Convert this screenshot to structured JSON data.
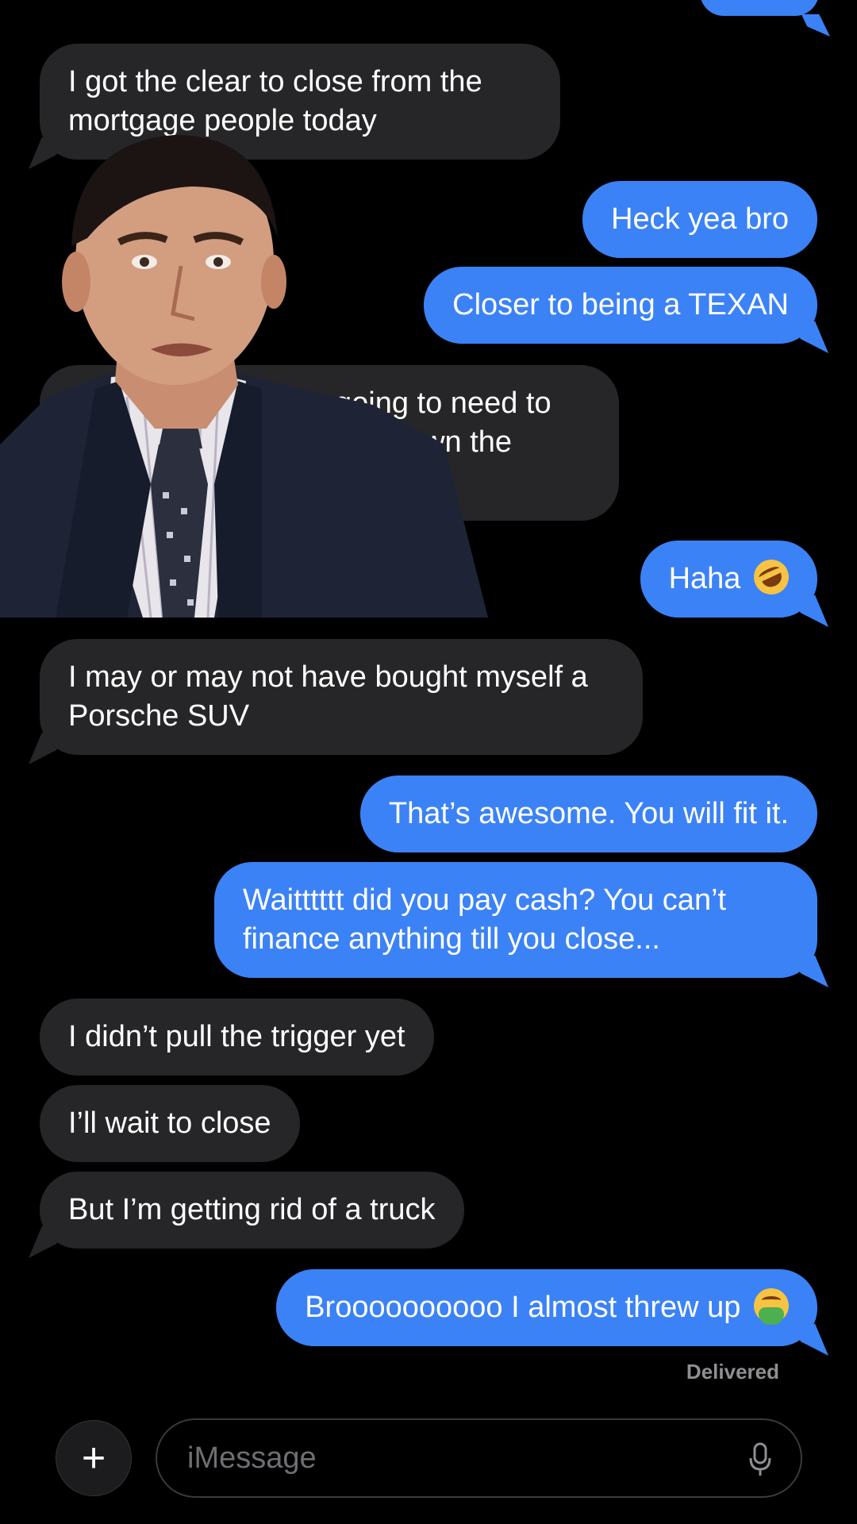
{
  "messages": [
    {
      "id": "m1",
      "dir": "recv",
      "text": "I got the clear to close from the mortgage people today"
    },
    {
      "id": "m2",
      "dir": "sent",
      "text": "Heck yea bro"
    },
    {
      "id": "m3",
      "dir": "sent",
      "text": "Closer to being a TEXAN"
    },
    {
      "id": "m4",
      "dir": "recv",
      "text": "I'm going to need to act like I own the place"
    },
    {
      "id": "m5",
      "dir": "sent",
      "text": "Haha"
    },
    {
      "id": "m6",
      "dir": "recv",
      "text": "I may or may not have bought myself a Porsche SUV"
    },
    {
      "id": "m7",
      "dir": "sent",
      "text": "That’s awesome. You will fit it."
    },
    {
      "id": "m8",
      "dir": "sent",
      "text": "Waitttttt did you pay cash? You can’t finance anything till you close..."
    },
    {
      "id": "m9",
      "dir": "recv",
      "text": "I didn’t pull the trigger yet"
    },
    {
      "id": "m10",
      "dir": "recv",
      "text": "I’ll wait to close"
    },
    {
      "id": "m11",
      "dir": "recv",
      "text": "But I’m getting rid of a truck"
    },
    {
      "id": "m12",
      "dir": "sent",
      "text": "Broooooooooo I almost threw up"
    }
  ],
  "emojis": {
    "m5": "rolling-on-floor-laughing",
    "m12": "face-vomiting"
  },
  "status": "Delivered",
  "compose": {
    "placeholder": "iMessage"
  },
  "colors": {
    "sent": "#3b82f6",
    "received": "#262628",
    "background": "#000000"
  }
}
